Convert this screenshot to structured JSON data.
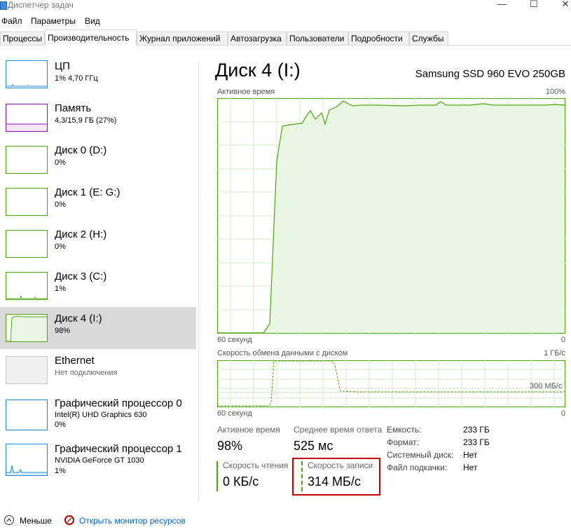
{
  "window": {
    "title": "Диспетчер задач",
    "controls": {
      "minimize": "—",
      "maximize": "☐",
      "close": "✕"
    }
  },
  "menu": [
    "Файл",
    "Параметры",
    "Вид"
  ],
  "tabs": [
    "Процессы",
    "Производительность",
    "Журнал приложений",
    "Автозагрузка",
    "Пользователи",
    "Подробности",
    "Службы"
  ],
  "active_tab": "Производительность",
  "sidebar": {
    "items": [
      {
        "name": "ЦП",
        "sub1": "1% 4,70 ГГц",
        "sub2": ""
      },
      {
        "name": "Память",
        "sub1": "4,3/15,9 ГБ (27%)",
        "sub2": ""
      },
      {
        "name": "Диск 0 (D:)",
        "sub1": "0%",
        "sub2": ""
      },
      {
        "name": "Диск 1 (E: G:)",
        "sub1": "0%",
        "sub2": ""
      },
      {
        "name": "Диск 2 (H:)",
        "sub1": "0%",
        "sub2": ""
      },
      {
        "name": "Диск 3 (C:)",
        "sub1": "1%",
        "sub2": ""
      },
      {
        "name": "Диск 4 (I:)",
        "sub1": "98%",
        "sub2": ""
      },
      {
        "name": "Ethernet",
        "sub1": "Нет подключения",
        "sub2": ""
      },
      {
        "name": "Графический процессор 0",
        "sub1": "Intel(R) UHD Graphics 630",
        "sub2": "0%"
      },
      {
        "name": "Графический процессор 1",
        "sub1": "NVIDIA GeForce GT 1030",
        "sub2": "1%"
      }
    ],
    "selected_index": 6
  },
  "detail": {
    "title": "Диск 4 (I:)",
    "model": "Samsung SSD 960 EVO 250GB",
    "active_graph": {
      "label": "Активное время",
      "max": "100%",
      "x_label": "60 секунд",
      "min": "0"
    },
    "transfer_graph": {
      "label": "Скорость обмена данными с диском",
      "max": "1 ГБ/с",
      "mid": "300 МБ/с",
      "x_label": "60 секунд",
      "min": "0"
    },
    "stats": {
      "active_time_label": "Активное время",
      "active_time_value": "98%",
      "avg_response_label": "Среднее время ответа",
      "avg_response_value": "525 мс",
      "read_label": "Скорость чтения",
      "read_value": "0 КБ/с",
      "write_label": "Скорость записи",
      "write_value": "314 МБ/с"
    },
    "properties": [
      {
        "label": "Емкость:",
        "value": "233 ГБ"
      },
      {
        "label": "Формат:",
        "value": "233 ГБ"
      },
      {
        "label": "Системный диск:",
        "value": "Нет"
      },
      {
        "label": "Файл подкачки:",
        "value": "Нет"
      }
    ]
  },
  "footer": {
    "less": "Меньше",
    "resource_monitor": "Открыть монитор ресурсов"
  },
  "colors": {
    "disk": "#4da60c",
    "disk_fill": "#eaf6e4",
    "cpu": "#1e8bd3",
    "memory": "#8b12ae",
    "ethernet": "#a0a0a0",
    "highlight": "#c40000"
  },
  "icons": {
    "app": "task-manager-icon",
    "less": "chevron-up-icon",
    "resource_monitor": "resource-monitor-icon"
  }
}
